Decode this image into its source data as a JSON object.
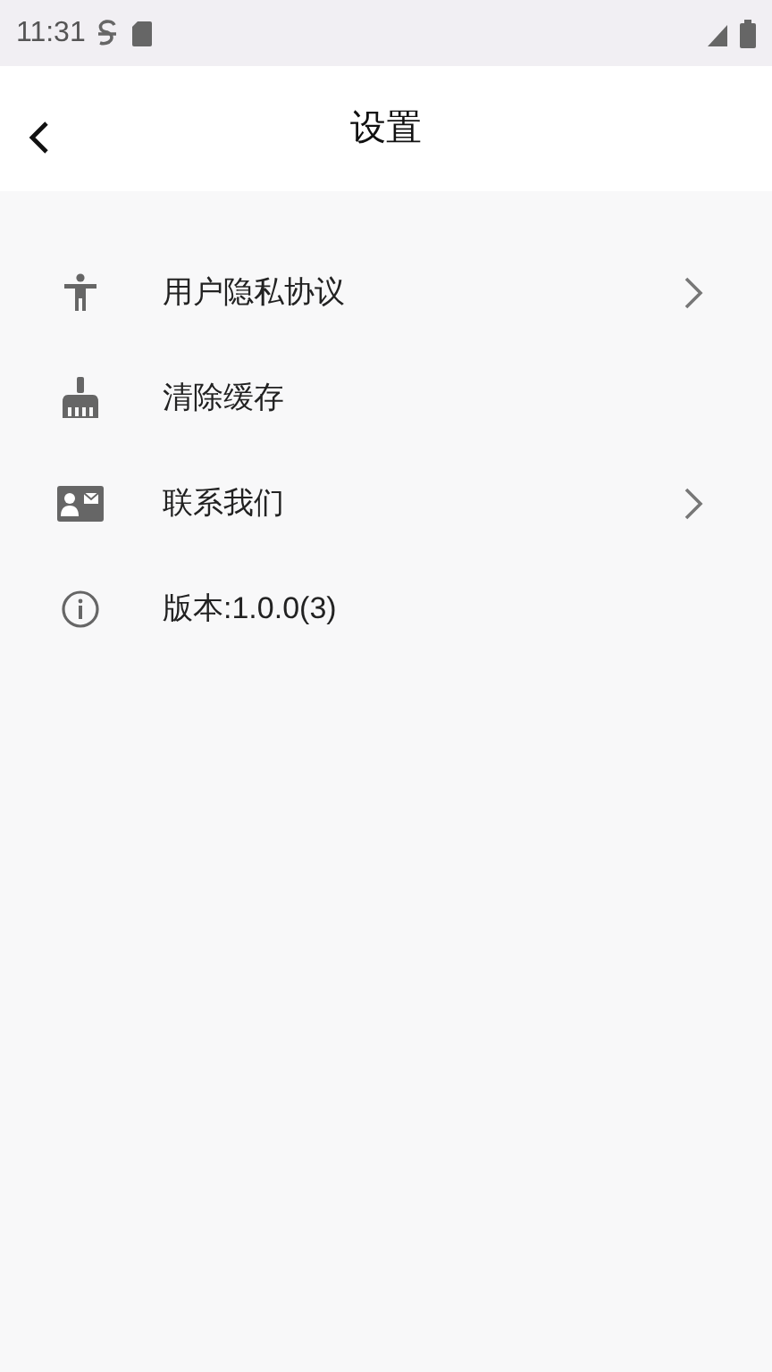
{
  "status_bar": {
    "time": "11:31"
  },
  "header": {
    "title": "设置"
  },
  "items": [
    {
      "kind": "accessibility",
      "label": "用户隐私协议",
      "chevron": true
    },
    {
      "kind": "broom",
      "label": "清除缓存",
      "chevron": false
    },
    {
      "kind": "contact",
      "label": "联系我们",
      "chevron": true
    },
    {
      "kind": "info",
      "label": "版本:1.0.0(3)",
      "chevron": false
    }
  ]
}
